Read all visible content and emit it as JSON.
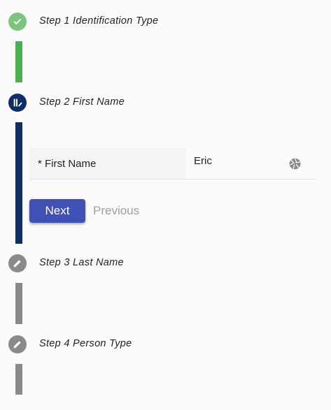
{
  "steps": [
    {
      "label": "Step 1 Identification Type",
      "status": "completed",
      "icon": "check-icon"
    },
    {
      "label": "Step 2 First Name",
      "status": "active",
      "icon": "edit-active-icon"
    },
    {
      "label": "Step 3 Last Name",
      "status": "pending",
      "icon": "pencil-icon"
    },
    {
      "label": "Step 4 Person Type",
      "status": "pending",
      "icon": "pencil-icon"
    }
  ],
  "field": {
    "label": "* First Name",
    "value": "Eric",
    "icon": "aperture-icon"
  },
  "buttons": {
    "next": "Next",
    "previous": "Previous"
  },
  "colors": {
    "completed": "#7cc47f",
    "completed_bar": "#4caf50",
    "active": "#0d2f66",
    "pending": "#8a8a8a",
    "primary": "#3f51b5"
  }
}
